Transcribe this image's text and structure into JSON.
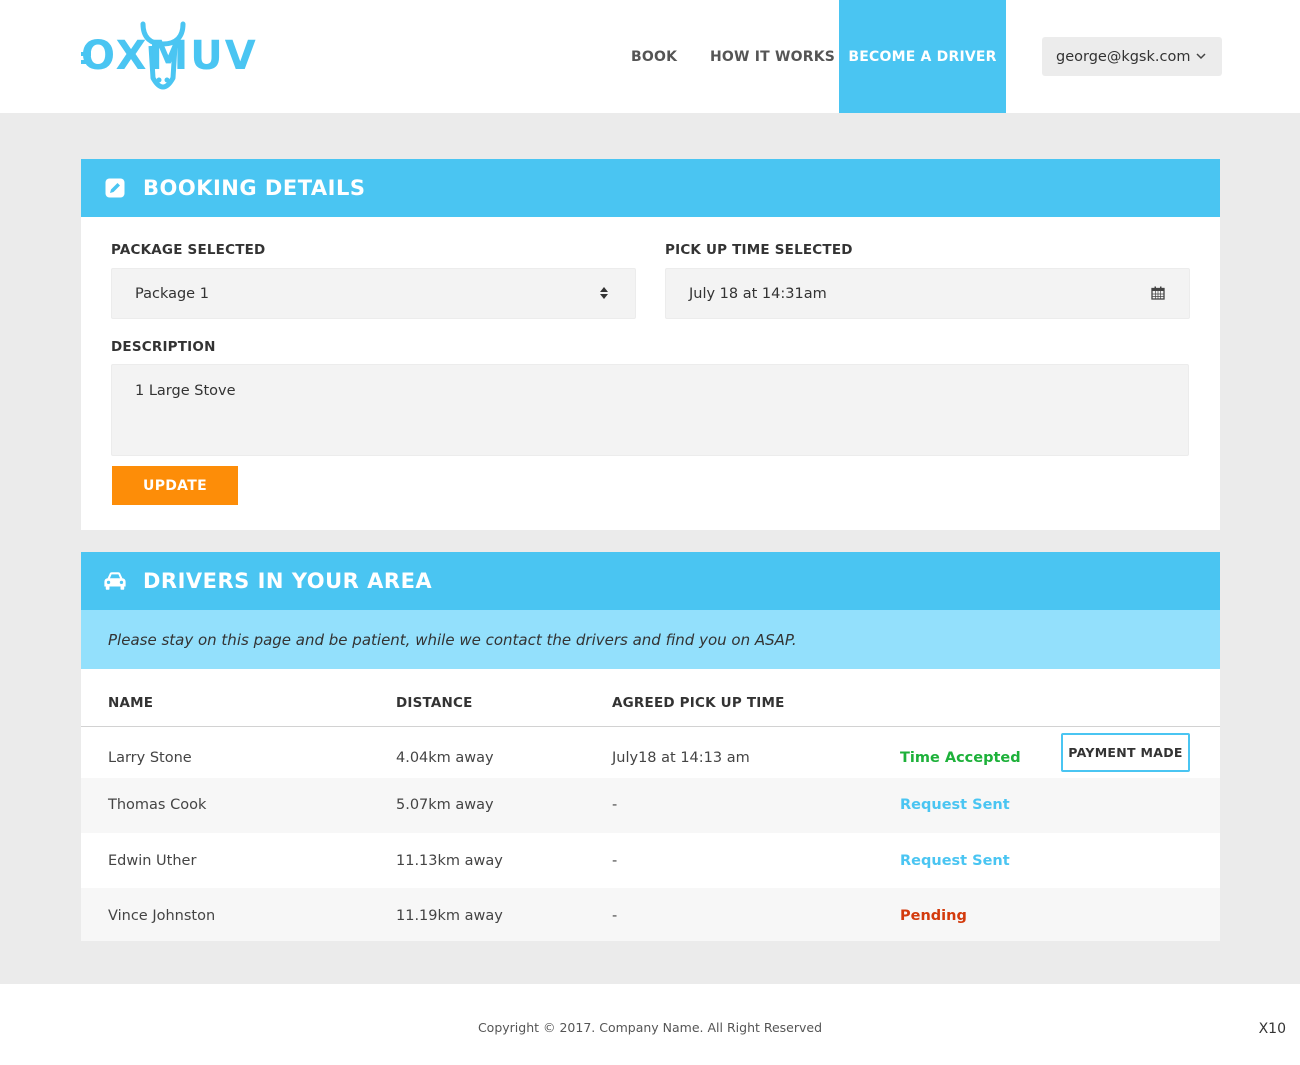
{
  "header": {
    "logo_text": "OXMUV",
    "nav": {
      "book": "BOOK",
      "how_it_works": "HOW IT WORKS",
      "become_driver": "BECOME A DRIVER"
    },
    "user_email": "george@kgsk.com"
  },
  "booking": {
    "title": "BOOKING DETAILS",
    "package_label": "PACKAGE SELECTED",
    "package_value": "Package 1",
    "pickup_label": "PICK UP TIME SELECTED",
    "pickup_value": "July 18 at 14:31am",
    "description_label": "DESCRIPTION",
    "description_value": "1 Large Stove",
    "update_button": "UPDATE"
  },
  "drivers": {
    "title": "DRIVERS IN YOUR AREA",
    "notice": "Please stay on this page and be patient, while we contact the drivers and find you on ASAP.",
    "columns": {
      "name": "NAME",
      "distance": "DISTANCE",
      "agreed_time": "AGREED PICK UP TIME"
    },
    "rows": [
      {
        "name": "Larry Stone",
        "distance": "4.04km away",
        "time": "July18 at 14:13 am",
        "status": "Time Accepted",
        "status_color": "#1db13a",
        "action": "PAYMENT MADE"
      },
      {
        "name": "Thomas Cook",
        "distance": "5.07km away",
        "time": "-",
        "status": "Request Sent",
        "status_color": "#4ac5f2"
      },
      {
        "name": "Edwin Uther",
        "distance": "11.13km away",
        "time": "-",
        "status": "Request Sent",
        "status_color": "#4ac5f2"
      },
      {
        "name": "Vince Johnston",
        "distance": "11.19km away",
        "time": "-",
        "status": "Pending",
        "status_color": "#d33a0c"
      }
    ]
  },
  "footer": {
    "copyright": "Copyright © 2017. Company Name. All Right Reserved",
    "zoom": "X10"
  },
  "colors": {
    "brand": "#4ac5f2",
    "accent": "#fd8d08",
    "notice_bg": "#93e0fc"
  },
  "icons": [
    "logo-bull-icon",
    "chevron-down-icon",
    "edit-icon",
    "sort-icon",
    "calendar-icon",
    "car-icon"
  ]
}
